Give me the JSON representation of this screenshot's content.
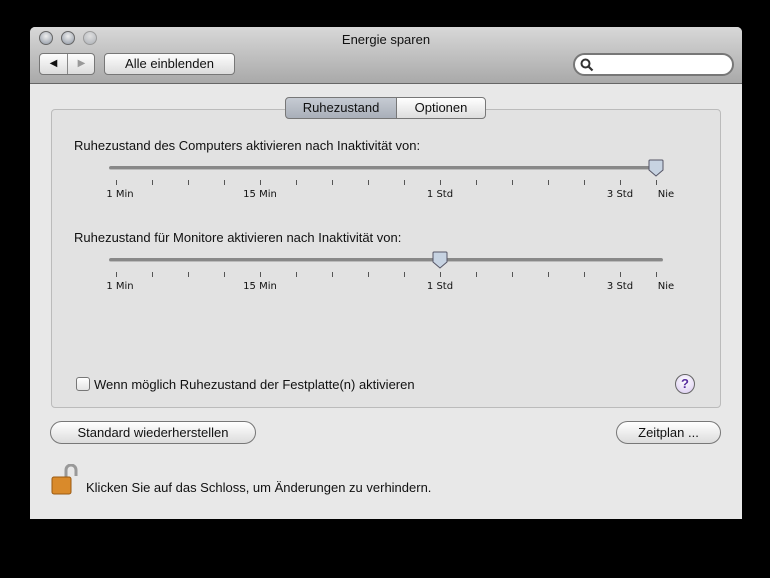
{
  "window": {
    "title": "Energie sparen"
  },
  "toolbar": {
    "back_icon": "◀",
    "forward_icon": "▶",
    "show_all_label": "Alle einblenden",
    "search_placeholder": ""
  },
  "tabs": [
    {
      "label": "Ruhezustand",
      "selected": true
    },
    {
      "label": "Optionen",
      "selected": false
    }
  ],
  "sliders": [
    {
      "label": "Ruhezustand des Computers aktivieren nach Inaktivität von:",
      "value_fraction": 1.0,
      "value_label": "Nie"
    },
    {
      "label": "Ruhezustand für Monitore aktivieren nach Inaktivität von:",
      "value_fraction": 0.6,
      "value_label": "1 Std"
    }
  ],
  "tick_count": 16,
  "tick_labels": [
    {
      "text": "1 Min",
      "tick": 0
    },
    {
      "text": "15 Min",
      "tick": 4
    },
    {
      "text": "1 Std",
      "tick": 9
    },
    {
      "text": "3 Std",
      "tick": 14
    },
    {
      "text": "Nie",
      "tick": 15
    }
  ],
  "disk_sleep": {
    "label": "Wenn möglich Ruhezustand der Festplatte(n) aktivieren",
    "checked": false
  },
  "help_icon": "?",
  "buttons": {
    "restore_defaults": "Standard wiederherstellen",
    "schedule": "Zeitplan ..."
  },
  "lock": {
    "text": "Klicken Sie auf das Schloss, um Änderungen zu verhindern.",
    "state": "unlocked"
  }
}
